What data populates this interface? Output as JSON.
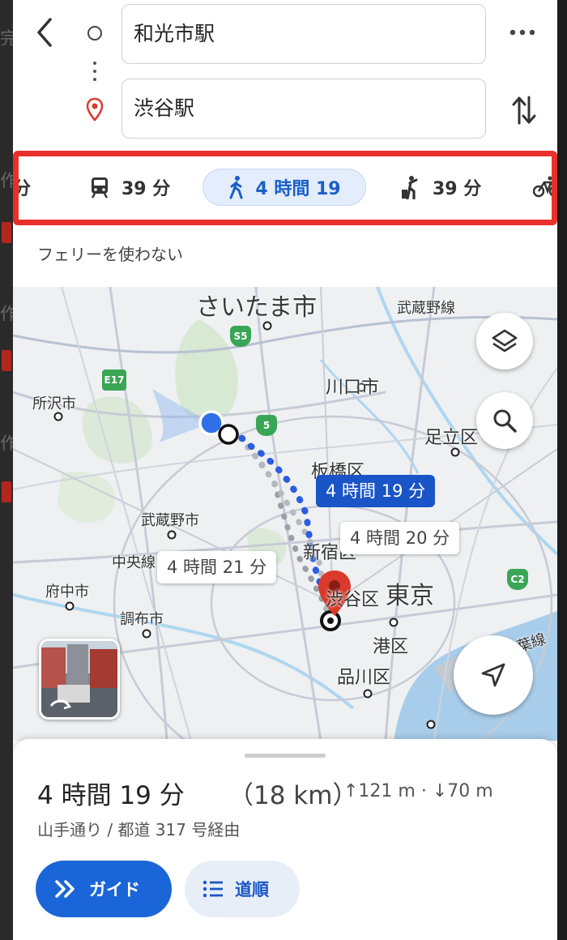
{
  "route": {
    "origin": "和光市駅",
    "destination": "渋谷駅"
  },
  "modes": [
    {
      "name": "driving-partial",
      "label": "分"
    },
    {
      "name": "transit",
      "label": "39 分"
    },
    {
      "name": "walking",
      "label": "4 時間 19",
      "selected": true
    },
    {
      "name": "ride",
      "label": "39 分"
    },
    {
      "name": "cycling",
      "label": ""
    }
  ],
  "route_option": "フェリーを使わない",
  "map": {
    "labels": {
      "saitama": "さいたま市",
      "musashino_line": "武蔵野線",
      "kawaguchi": "川口市",
      "tokorozawa": "所沢市",
      "adachi": "足立区",
      "itabashi": "板橋区",
      "musashino": "武蔵野市",
      "chuo_line": "中央線",
      "shinjuku": "新宿区",
      "fuchu": "府中市",
      "chofu": "調布市",
      "shibuya": "渋谷区",
      "tokyo": "東京",
      "minato": "港区",
      "shinagawa": "品川区",
      "keiyo_line": "京葉線"
    },
    "shields": {
      "s5": "S5",
      "e17": "E17",
      "r5": "5",
      "c2": "C2"
    },
    "callouts": {
      "selected": "4 時間 19 分",
      "alt1": "4 時間 20 分",
      "alt2": "4 時間 21 分"
    }
  },
  "summary": {
    "duration": "4 時間 19 分",
    "distance": "（18 km）",
    "elevation": "↑121 m · ↓70 m",
    "via": "山手通り / 都道 317 号経由"
  },
  "buttons": {
    "guide": "ガイド",
    "steps": "道順"
  },
  "colors": {
    "accent": "#1a66d8",
    "route_blue": "#1a55c7",
    "highlight_box": "#e8302a",
    "destination_pin": "#d93a2b"
  }
}
